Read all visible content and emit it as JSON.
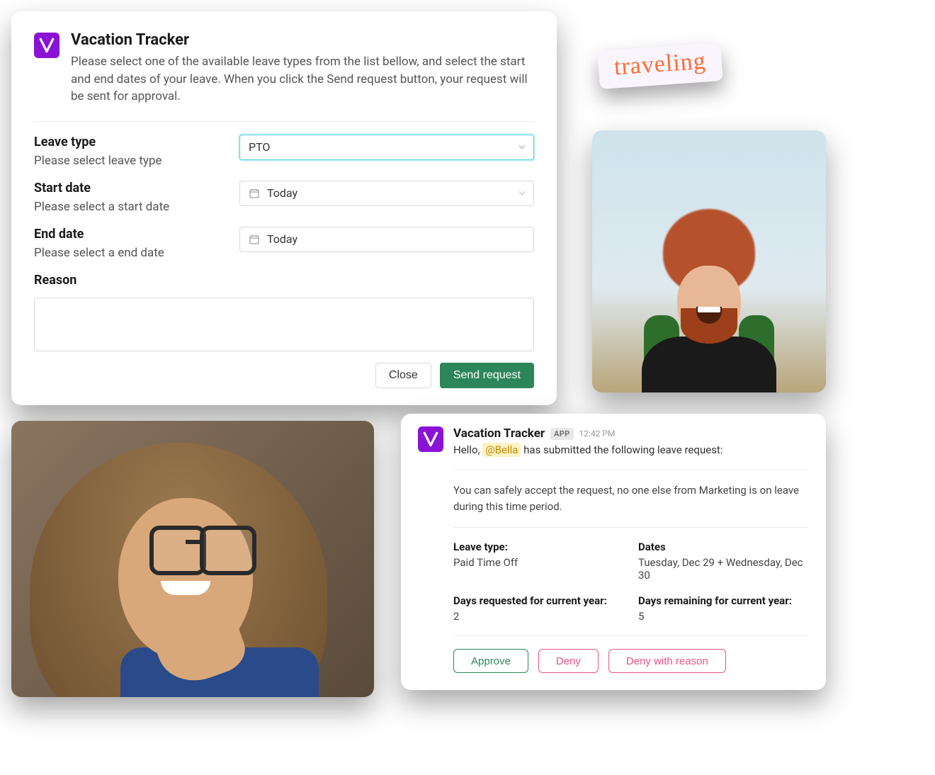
{
  "form": {
    "app_name": "Vacation Tracker",
    "description": "Please select one of the available leave types from the list bellow, and select the start and end dates of your leave. When you click the Send request button, your request will be sent for approval.",
    "leave_type": {
      "label": "Leave type",
      "sub": "Please select leave type",
      "value": "PTO"
    },
    "start_date": {
      "label": "Start date",
      "sub": "Please select a start date",
      "value": "Today"
    },
    "end_date": {
      "label": "End date",
      "sub": "Please select a end date",
      "value": "Today"
    },
    "reason": {
      "label": "Reason",
      "value": ""
    },
    "close_label": "Close",
    "send_label": "Send request"
  },
  "sticker": {
    "text": "traveling"
  },
  "message": {
    "app_name": "Vacation Tracker",
    "badge": "APP",
    "time": "12:42 PM",
    "greeting_prefix": "Hello, ",
    "mention": "@Bella",
    "greeting_suffix": " has submitted the following leave request:",
    "body": "You can safely accept the request, no one else from Marketing is on leave during this time period.",
    "fields": {
      "leave_type_k": "Leave type:",
      "leave_type_v": "Paid Time Off",
      "dates_k": "Dates",
      "dates_v": "Tuesday, Dec 29 + Wednesday, Dec 30",
      "days_req_k": "Days requested for current year:",
      "days_req_v": "2",
      "days_rem_k": "Days remaining for current year:",
      "days_rem_v": "5"
    },
    "approve_label": "Approve",
    "deny_label": "Deny",
    "deny_reason_label": "Deny with reason"
  }
}
